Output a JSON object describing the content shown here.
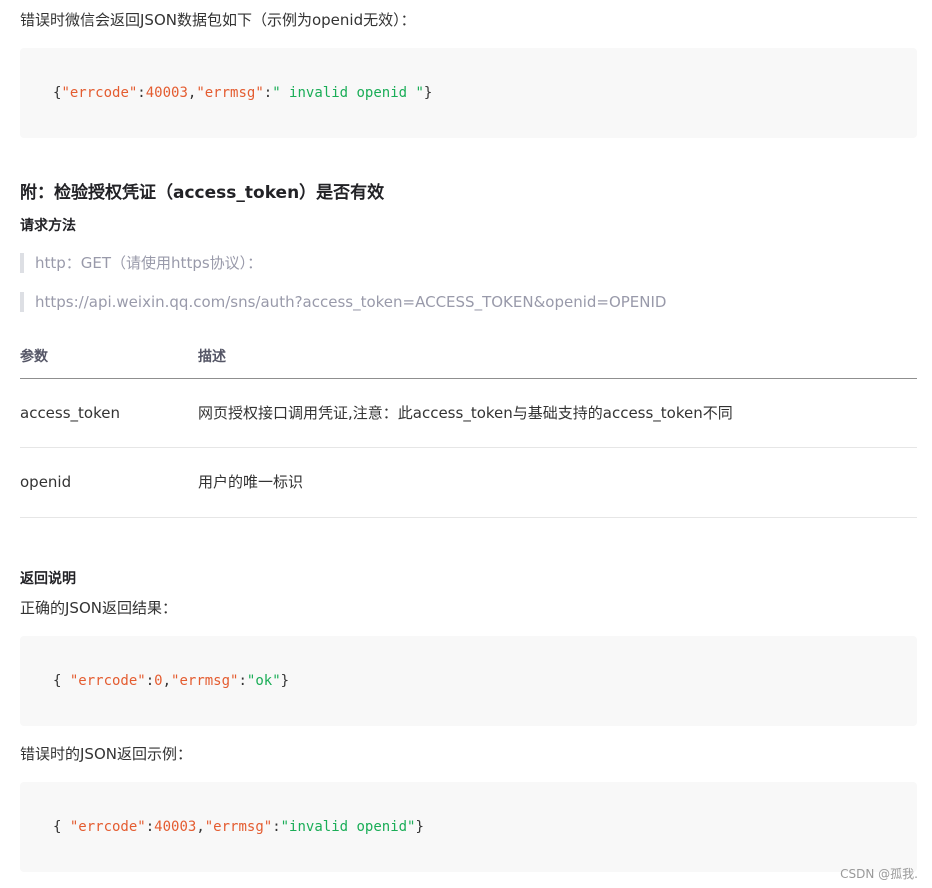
{
  "intro_error": "错误时微信会返回JSON数据包如下（示例为openid无效）：",
  "code1": {
    "open": "{",
    "k1": "\"errcode\"",
    "c1": ":",
    "v1": "40003",
    "comma": ",",
    "k2": "\"errmsg\"",
    "c2": ":",
    "v2": "\" invalid openid \"",
    "close": "}"
  },
  "heading": "附：检验授权凭证（access_token）是否有效",
  "request_method_title": "请求方法",
  "quote1": "http：GET（请使用https协议）：",
  "quote2": "https://api.weixin.qq.com/sns/auth?access_token=ACCESS_TOKEN&openid=OPENID",
  "table": {
    "headers": [
      "参数",
      "描述"
    ],
    "rows": [
      [
        "access_token",
        "网页授权接口调用凭证,注意：此access_token与基础支持的access_token不同"
      ],
      [
        "openid",
        "用户的唯一标识"
      ]
    ]
  },
  "return_title": "返回说明",
  "ok_intro": "正确的JSON返回结果：",
  "code2": {
    "open": "{ ",
    "k1": "\"errcode\"",
    "c1": ":",
    "v1": "0",
    "comma": ",",
    "k2": "\"errmsg\"",
    "c2": ":",
    "v2": "\"ok\"",
    "close": "}"
  },
  "err_intro": "错误时的JSON返回示例：",
  "code3": {
    "open": "{ ",
    "k1": "\"errcode\"",
    "c1": ":",
    "v1": "40003",
    "comma": ",",
    "k2": "\"errmsg\"",
    "c2": ":",
    "v2": "\"invalid openid\"",
    "close": "}"
  },
  "watermark": "CSDN @孤我.",
  "colors": {
    "code_key": "#e45c30",
    "code_string": "#1aad57",
    "code_bg": "#f8f8f8"
  }
}
